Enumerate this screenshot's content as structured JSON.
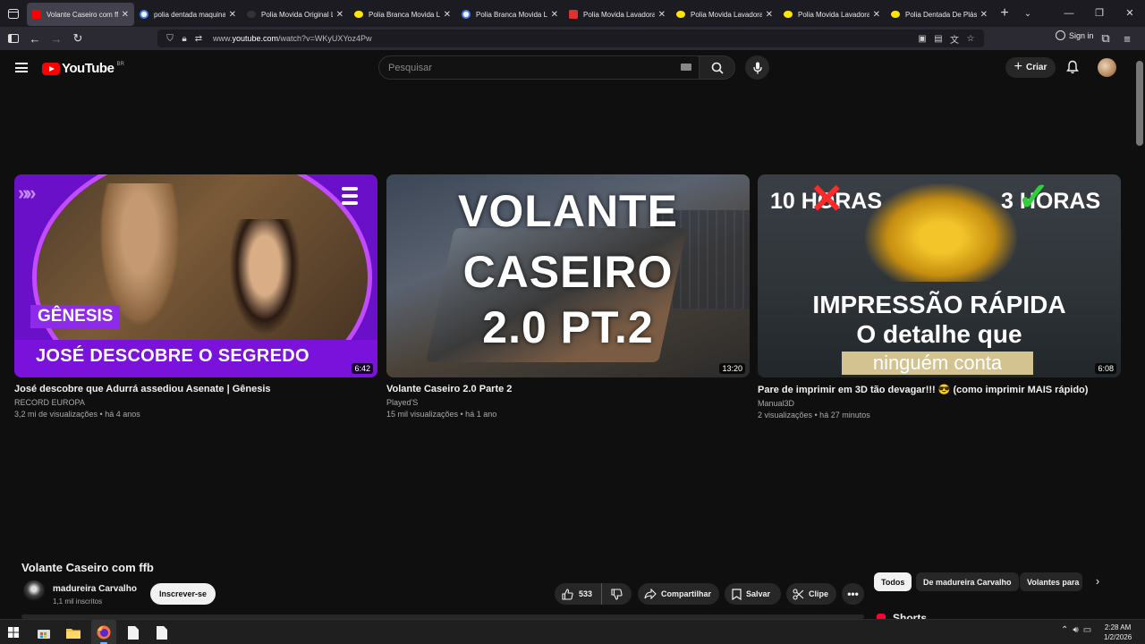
{
  "browser": {
    "tabs": [
      {
        "label": "Volante Caseiro com ffb",
        "favicon": "youtube-red-icon",
        "color": "#ff0000",
        "active": true
      },
      {
        "label": "polia dentada maquina",
        "favicon": "google-icon",
        "color": "#4285f4",
        "active": false
      },
      {
        "label": "Polia Movida Original L",
        "favicon": "mercadolivre-icon",
        "color": "#333333",
        "active": false
      },
      {
        "label": "Polia Branca Movida La",
        "favicon": "mercadolivre-icon",
        "color": "#ffe600",
        "active": false
      },
      {
        "label": "Polia Branca Movida La",
        "favicon": "google-icon",
        "color": "#4285f4",
        "active": false
      },
      {
        "label": "Polia Movida Lavadora",
        "favicon": "shop-icon",
        "color": "#e03030",
        "active": false
      },
      {
        "label": "Polia Movida Lavadora",
        "favicon": "mercadolivre-icon",
        "color": "#ffe600",
        "active": false
      },
      {
        "label": "Polia Movida Lavadora",
        "favicon": "mercadolivre-icon",
        "color": "#ffe600",
        "active": false
      },
      {
        "label": "Polia Dentada De Plásti",
        "favicon": "mercadolivre-icon",
        "color": "#ffe600",
        "active": false
      }
    ],
    "url_prefix": "www.",
    "url_domain": "youtube.com",
    "url_path": "/watch?v=WKyUXYoz4Pw",
    "signin_label": "Sign in"
  },
  "youtube": {
    "logo_text": "YouTube",
    "country_code": "BR",
    "search_placeholder": "Pesquisar",
    "create_label": "Criar"
  },
  "end_screen_videos": [
    {
      "title": "José descobre que Adurrá assediou Asenate | Gênesis",
      "channel": "RECORD EUROPA",
      "meta": "3,2 mi de visualizações • há 4 anos",
      "duration": "6:42",
      "thumb_text": {
        "tag": "GÊNESIS",
        "headline": "JOSÉ DESCOBRE O SEGREDO"
      }
    },
    {
      "title": "Volante Caseiro 2.0 Parte 2",
      "channel": "Played'S",
      "meta": "15 mil visualizações • há 1 ano",
      "duration": "13:20",
      "thumb_text": {
        "line1": "VOLANTE",
        "line2": "CASEIRO",
        "line3": "2.0 PT.2"
      }
    },
    {
      "title": "Pare de imprimir em 3D tão devagar!!! 😎 (como imprimir MAIS rápido)",
      "channel": "Manual3D",
      "meta": "2 visualizações • há 27 minutos",
      "duration": "6:08",
      "thumb_text": {
        "left": "10 HORAS",
        "right": "3 HORAS",
        "line1": "IMPRESSÃO RÁPIDA",
        "line2": "O detalhe que",
        "line3": "ninguém conta"
      }
    }
  ],
  "watch": {
    "title": "Volante Caseiro com ffb",
    "channel_name": "madureira Carvalho",
    "subscribers": "1,1 mil inscritos",
    "subscribe_label": "Inscrever-se",
    "likes": "533",
    "share_label": "Compartilhar",
    "save_label": "Salvar",
    "clip_label": "Clipe"
  },
  "chips": {
    "all": "Todos",
    "channel": "De madureira Carvalho",
    "related": "Volantes para"
  },
  "shorts_label": "Shorts",
  "taskbar": {
    "time": "2:28 AM",
    "date": "1/2/2026"
  },
  "colors": {
    "yt_red": "#ff0000",
    "background": "#0f0f0f",
    "chip_bg": "#272727"
  }
}
